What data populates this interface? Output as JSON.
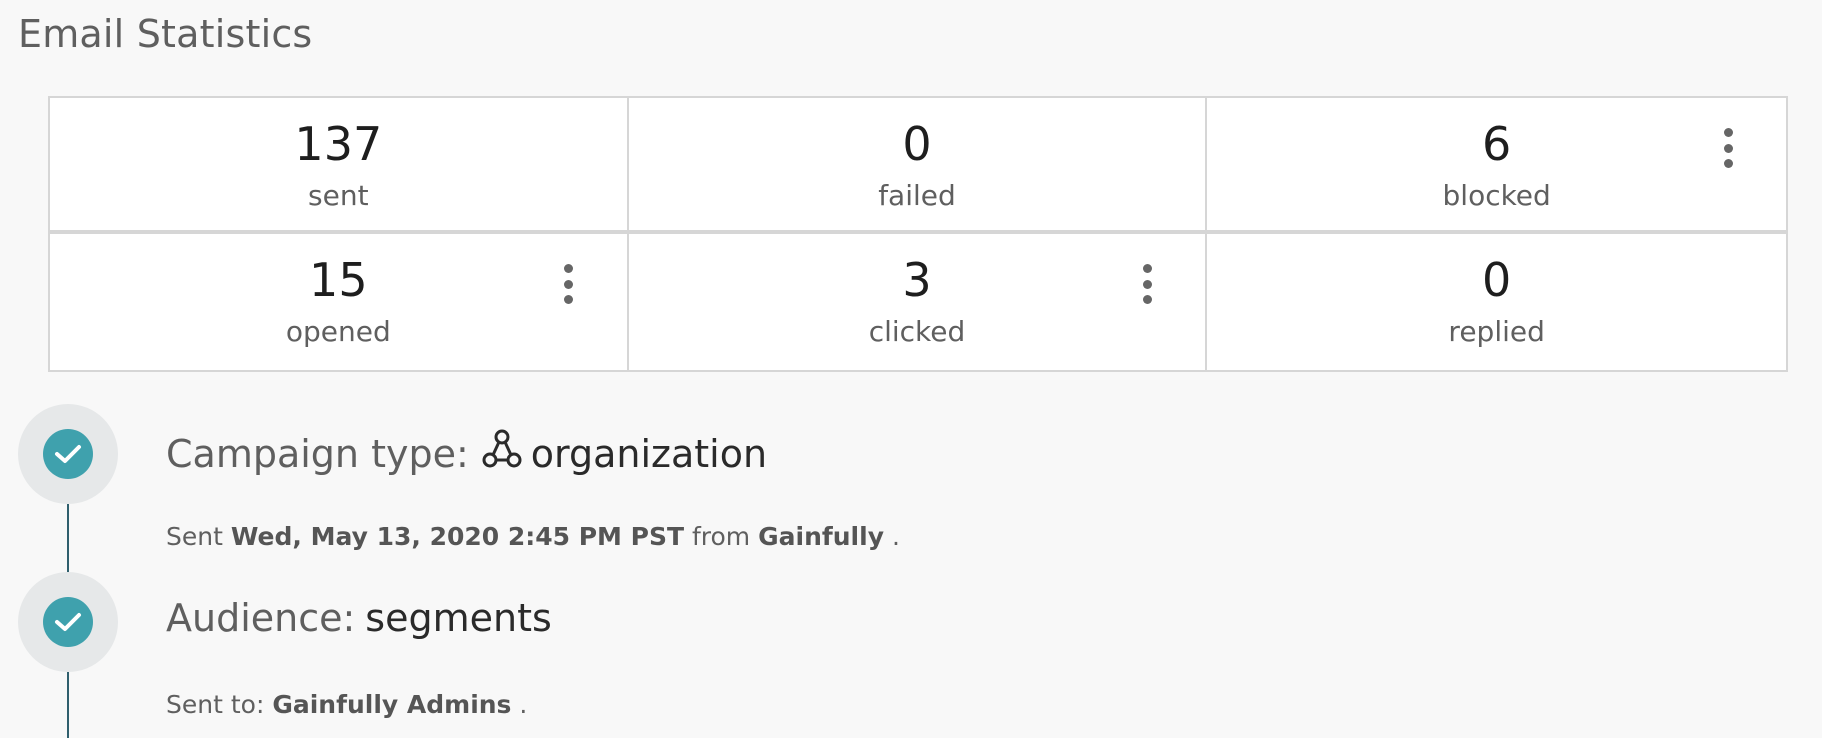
{
  "section": {
    "title": "Email Statistics"
  },
  "stats": [
    {
      "value": "137",
      "label": "sent",
      "menu": false
    },
    {
      "value": "0",
      "label": "failed",
      "menu": false
    },
    {
      "value": "6",
      "label": "blocked",
      "menu": true
    },
    {
      "value": "15",
      "label": "opened",
      "menu": true
    },
    {
      "value": "3",
      "label": "clicked",
      "menu": true
    },
    {
      "value": "0",
      "label": "replied",
      "menu": false
    }
  ],
  "timeline": {
    "campaign": {
      "label": "Campaign type:",
      "icon": "organization-icon",
      "value": "organization",
      "sent_prefix": "Sent",
      "sent_date": "Wed, May 13, 2020 2:45 PM PST",
      "from_word": "from",
      "from_name": "Gainfully",
      "end": "."
    },
    "audience": {
      "label": "Audience:",
      "value": "segments",
      "sent_to_prefix": "Sent to:",
      "sent_to_name": "Gainfully Admins",
      "end": "."
    }
  },
  "colors": {
    "check_fill": "#3fa1ad",
    "timeline_line": "#2f5f6d",
    "circle_bg": "#e6e8e9",
    "card_border": "#d6d6d6"
  }
}
